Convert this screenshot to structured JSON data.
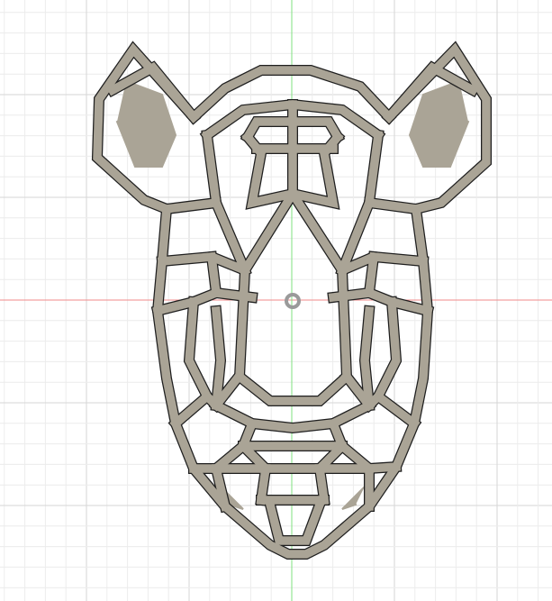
{
  "viewport": {
    "name": "sketch-canvas",
    "colors": {
      "background": "#ffffff",
      "grid_minor": "#ececec",
      "grid_major": "#d6d6d6",
      "x_axis": "#f08a8a",
      "y_axis": "#7fe07f",
      "body_fill": "#aaa496",
      "body_edge": "#1f1f1f",
      "origin": "#9a9a9a"
    }
  }
}
